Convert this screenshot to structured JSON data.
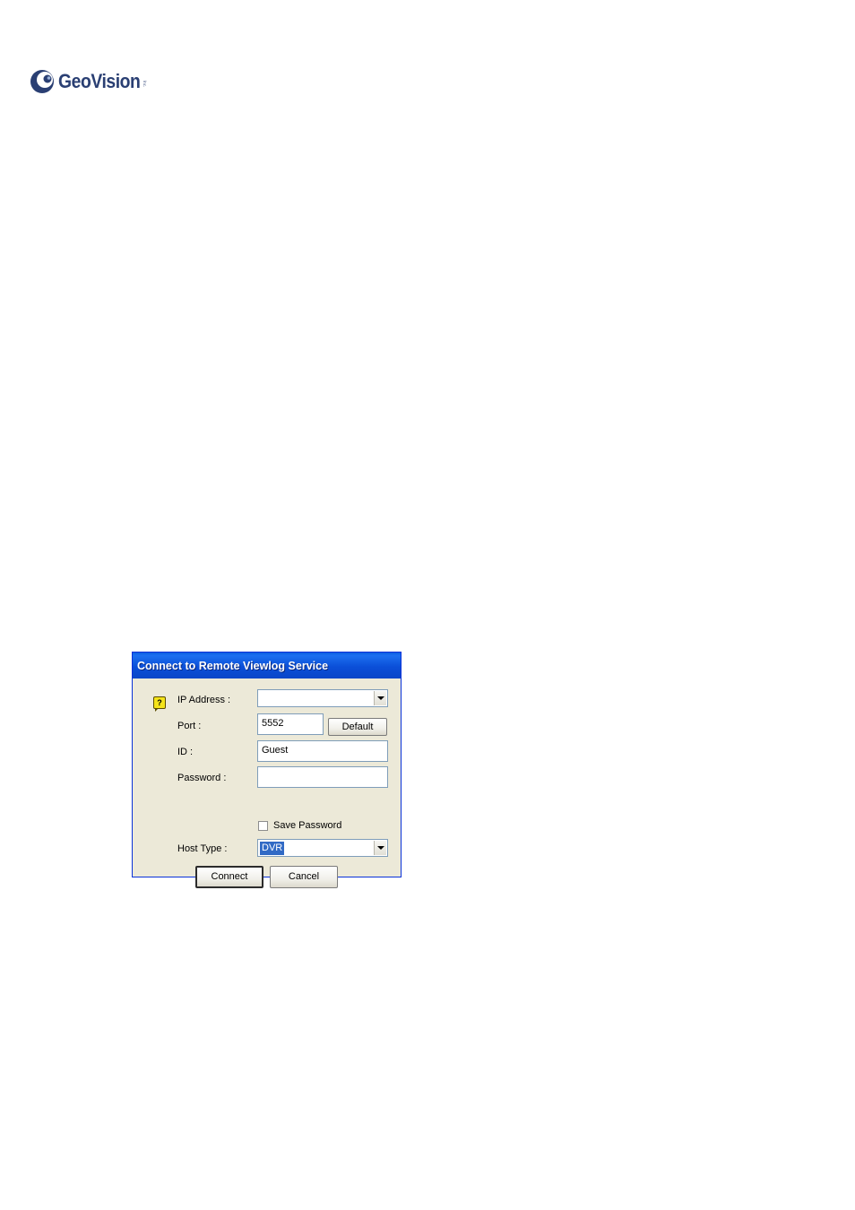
{
  "brand": {
    "name": "GeoVision",
    "mark": "Inc."
  },
  "dialog": {
    "title": "Connect to Remote Viewlog Service",
    "help_icon": "?",
    "fields": {
      "ip_address": {
        "label": "IP Address :",
        "value": ""
      },
      "port": {
        "label": "Port :",
        "value": "5552",
        "default_button": "Default"
      },
      "id": {
        "label": "ID :",
        "value": "Guest"
      },
      "password": {
        "label": "Password :",
        "value": ""
      },
      "save_password": {
        "label": "Save Password",
        "checked": false
      },
      "host_type": {
        "label": "Host Type :",
        "value": "DVR"
      }
    },
    "buttons": {
      "connect": "Connect",
      "cancel": "Cancel"
    }
  },
  "colors": {
    "brand": "#2a3f73",
    "titlebar": "#0a5ee0",
    "dialog_bg": "#ece9d8",
    "selection": "#316ac5"
  }
}
